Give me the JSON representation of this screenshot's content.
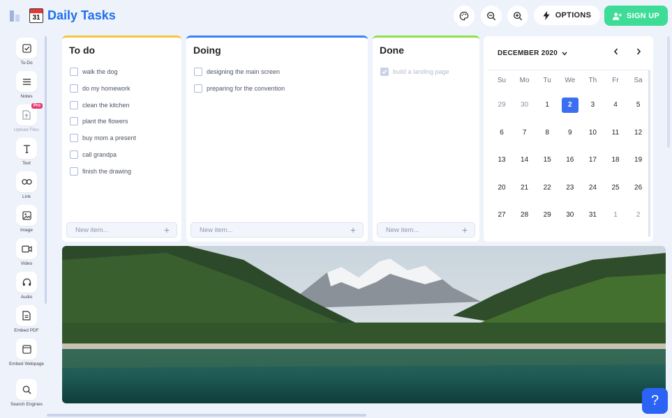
{
  "app": {
    "title": "Daily Tasks",
    "calendar_icon_day": "31"
  },
  "header": {
    "options_label": "OPTIONS",
    "signup_label": "SIGN UP",
    "accent": "#1f6feb",
    "signup_color": "#3ddc97"
  },
  "sidebar": {
    "items": [
      {
        "label": "To-Do",
        "icon": "todo-icon"
      },
      {
        "label": "Notes",
        "icon": "notes-icon"
      },
      {
        "label": "Upload Files",
        "icon": "upload-file-icon",
        "badge": "Pro"
      },
      {
        "label": "Text",
        "icon": "text-icon"
      },
      {
        "label": "Link",
        "icon": "link-icon"
      },
      {
        "label": "Image",
        "icon": "image-icon"
      },
      {
        "label": "Video",
        "icon": "video-icon"
      },
      {
        "label": "Audio",
        "icon": "audio-icon"
      },
      {
        "label": "Embed PDF",
        "icon": "pdf-icon"
      },
      {
        "label": "Embed Webpage",
        "icon": "webpage-icon"
      },
      {
        "label": "Search Engines",
        "icon": "search-icon"
      }
    ]
  },
  "columns": [
    {
      "title": "To do",
      "accent": "#f5c542",
      "tasks": [
        {
          "text": "walk the dog",
          "done": false
        },
        {
          "text": "do my homework",
          "done": false
        },
        {
          "text": "clean the kitchen",
          "done": false
        },
        {
          "text": "plant the flowers",
          "done": false
        },
        {
          "text": "buy mom a present",
          "done": false
        },
        {
          "text": "call grandpa",
          "done": false
        },
        {
          "text": "finish the drawing",
          "done": false
        }
      ],
      "new_item_placeholder": "New item..."
    },
    {
      "title": "Doing",
      "accent": "#3b82f6",
      "tasks": [
        {
          "text": "designing the main screen",
          "done": false
        },
        {
          "text": "preparing for the convention",
          "done": false
        }
      ],
      "new_item_placeholder": "New item..."
    },
    {
      "title": "Done",
      "accent": "#8fe04a",
      "tasks": [
        {
          "text": "build a landing page",
          "done": true
        }
      ],
      "new_item_placeholder": "New item..."
    }
  ],
  "calendar": {
    "month_label": "DECEMBER 2020",
    "weekdays": [
      "Su",
      "Mo",
      "Tu",
      "We",
      "Th",
      "Fr",
      "Sa"
    ],
    "weeks": [
      [
        "29",
        "30",
        "1",
        "2",
        "3",
        "4",
        "5"
      ],
      [
        "6",
        "7",
        "8",
        "9",
        "10",
        "11",
        "12"
      ],
      [
        "13",
        "14",
        "15",
        "16",
        "17",
        "18",
        "19"
      ],
      [
        "20",
        "21",
        "22",
        "23",
        "24",
        "25",
        "26"
      ],
      [
        "27",
        "28",
        "29",
        "30",
        "31",
        "1",
        "2"
      ]
    ],
    "selected_day": "2",
    "today_color": "#3b6ef0"
  },
  "help_label": "?"
}
